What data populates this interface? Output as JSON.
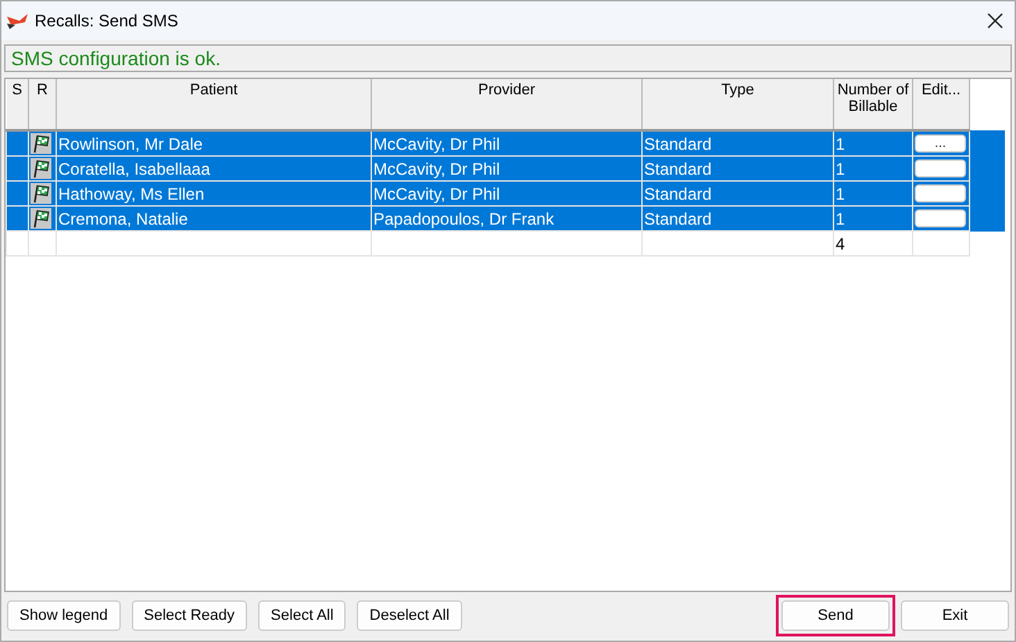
{
  "window": {
    "title": "Recalls: Send SMS"
  },
  "status_message": "SMS configuration is ok.",
  "table": {
    "columns": [
      "S",
      "R",
      "Patient",
      "Provider",
      "Type",
      "Number of Billable",
      "Edit..."
    ],
    "rows": [
      {
        "selected": true,
        "patient": "Rowlinson, Mr Dale",
        "provider": "McCavity, Dr Phil",
        "type": "Standard",
        "billable": "1",
        "edit_label": "..."
      },
      {
        "selected": true,
        "patient": "Coratella,  Isabellaaa",
        "provider": "McCavity, Dr Phil",
        "type": "Standard",
        "billable": "1"
      },
      {
        "selected": true,
        "patient": "Hathoway, Ms Ellen",
        "provider": "McCavity, Dr Phil",
        "type": "Standard",
        "billable": "1"
      },
      {
        "selected": true,
        "patient": "Cremona,  Natalie",
        "provider": "Papadopoulos, Dr Frank",
        "type": "Standard",
        "billable": "1"
      }
    ],
    "total": "4"
  },
  "buttons": [
    {
      "label": "Show legend",
      "highlighted": false
    },
    {
      "label": "Select Ready",
      "highlighted": false
    },
    {
      "label": "Select All",
      "highlighted": false
    },
    {
      "label": "Deselect All",
      "highlighted": false
    }
  ],
  "actions": [
    {
      "label": "Send",
      "highlighted": true
    },
    {
      "label": "Exit",
      "highlighted": false
    }
  ]
}
